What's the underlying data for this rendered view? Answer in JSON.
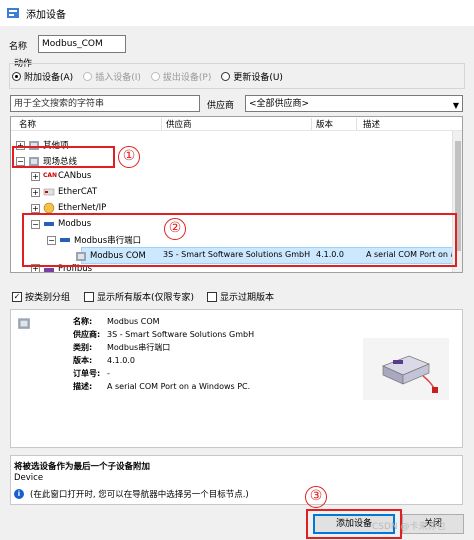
{
  "window": {
    "title": "添加设备"
  },
  "name_field": {
    "label": "名称",
    "value": "Modbus_COM"
  },
  "action": {
    "label": "动作",
    "options": [
      {
        "label": "附加设备(A)",
        "selected": true,
        "enabled": true
      },
      {
        "label": "插入设备(I)",
        "selected": false,
        "enabled": false
      },
      {
        "label": "拔出设备(P)",
        "selected": false,
        "enabled": false
      },
      {
        "label": "更新设备(U)",
        "selected": false,
        "enabled": true
      }
    ]
  },
  "search": {
    "placeholder": "用于全文搜索的字符串",
    "vendor_label": "供应商",
    "vendor_value": "<全部供应商>"
  },
  "tree": {
    "columns": [
      "名称",
      "供应商",
      "版本",
      "描述"
    ],
    "rows": {
      "misc": "其他项",
      "fieldbus": "现场总线",
      "canbus": "CANbus",
      "ethercat": "EtherCAT",
      "ethernetip": "EtherNet/IP",
      "modbus": "Modbus",
      "modbus_serial_port": "Modbus串行端口",
      "profibus": "Profibus"
    },
    "selected": {
      "name": "Modbus COM",
      "vendor": "3S - Smart Software Solutions GmbH",
      "version": "4.1.0.0",
      "description": "A serial COM Port on a W"
    }
  },
  "checkboxes": {
    "group_by_category": {
      "label": "按类别分组",
      "checked": true
    },
    "show_all_versions": {
      "label": "显示所有版本(仅限专家)",
      "checked": false
    },
    "show_obsolete": {
      "label": "显示过期版本",
      "checked": false
    }
  },
  "info": {
    "name_key": "名称:",
    "name_val": "Modbus COM",
    "vendor_key": "供应商:",
    "vendor_val": "3S - Smart Software Solutions GmbH",
    "category_key": "类别:",
    "category_val": "Modbus串行端口",
    "version_key": "版本:",
    "version_val": "4.1.0.0",
    "order_key": "订单号:",
    "order_val": "-",
    "desc_key": "描述:",
    "desc_val": "A serial COM Port on a Windows PC."
  },
  "bottom": {
    "heading": "将被选设备作为最后一个子设备附加",
    "device": "Device",
    "hint": "(在此窗口打开时, 您可以在导航器中选择另一个目标节点.)"
  },
  "buttons": {
    "add": "添加设备",
    "close": "关闭"
  },
  "annotations": {
    "one": "①",
    "two": "②",
    "three": "③"
  },
  "watermark": "CSDN @卡来你也",
  "colors": {
    "accent": "#0078d7",
    "annotation": "#e02020",
    "selection": "#cce8ff"
  }
}
